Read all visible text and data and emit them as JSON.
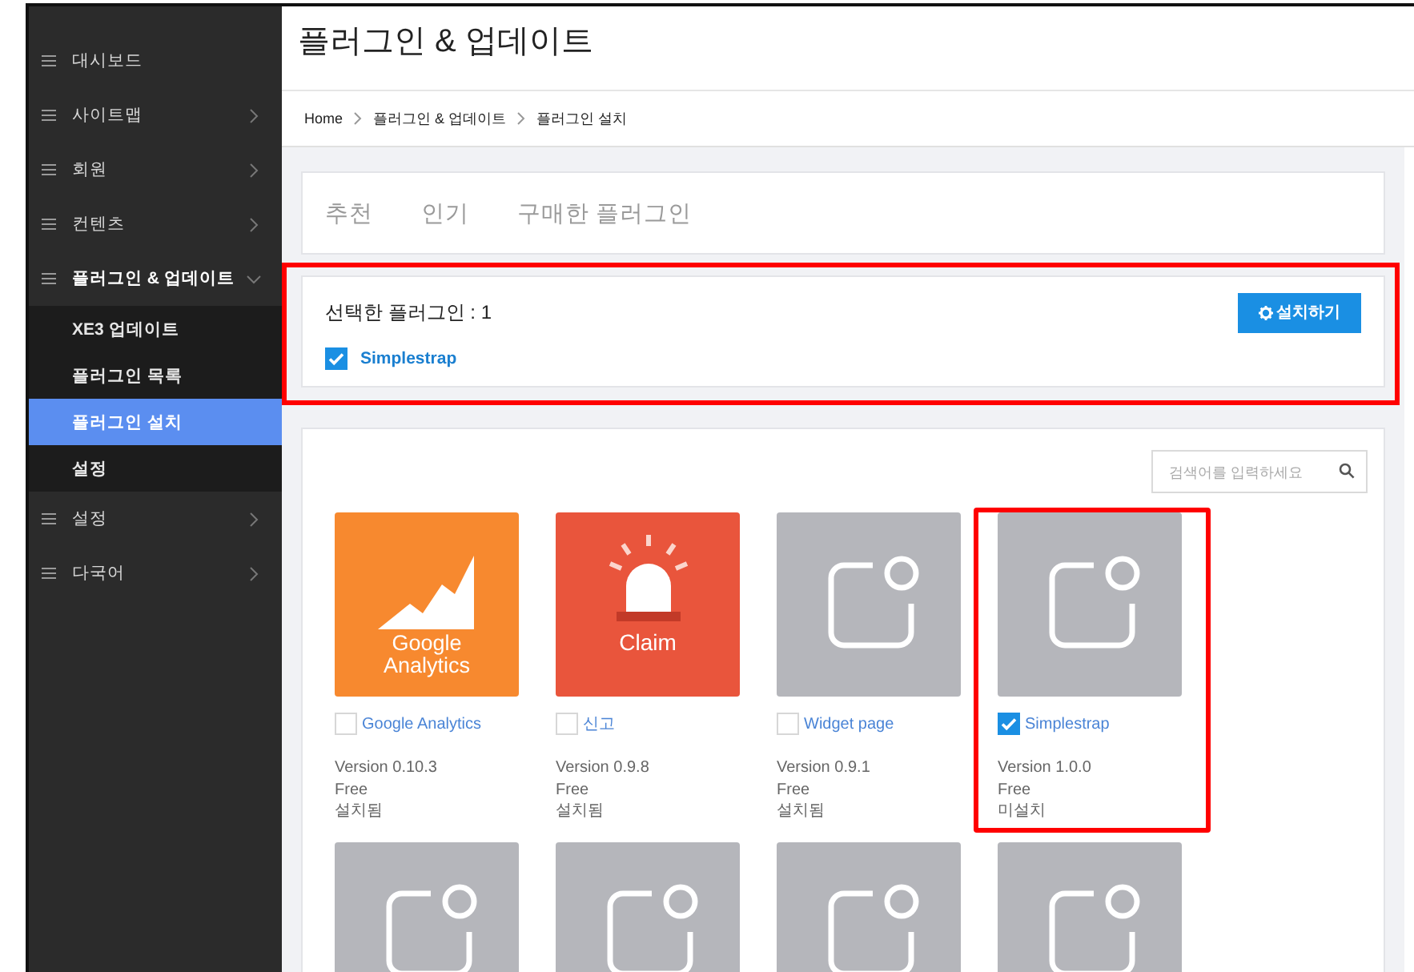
{
  "sidebar": {
    "items": [
      {
        "label": "대시보드",
        "expandable": false,
        "expanded": false
      },
      {
        "label": "사이트맵",
        "expandable": true,
        "expanded": false
      },
      {
        "label": "회원",
        "expandable": true,
        "expanded": false
      },
      {
        "label": "컨텐츠",
        "expandable": true,
        "expanded": false
      },
      {
        "label": "플러그인 & 업데이트",
        "expandable": true,
        "expanded": true,
        "children": [
          {
            "label": "XE3 업데이트",
            "selected": false
          },
          {
            "label": "플러그인 목록",
            "selected": false
          },
          {
            "label": "플러그인 설치",
            "selected": true
          },
          {
            "label": "설정",
            "selected": false
          }
        ]
      },
      {
        "label": "설정",
        "expandable": true,
        "expanded": false
      },
      {
        "label": "다국어",
        "expandable": true,
        "expanded": false
      }
    ]
  },
  "page": {
    "title": "플러그인 & 업데이트"
  },
  "breadcrumb": [
    "Home",
    "플러그인 & 업데이트",
    "플러그인 설치"
  ],
  "tabs": [
    {
      "label": "추천",
      "selected": false
    },
    {
      "label": "인기",
      "selected": false
    },
    {
      "label": "구매한 플러그인",
      "selected": false
    }
  ],
  "selection": {
    "highlighted": true,
    "label": "선택한 플러그인 : 1",
    "install_button": "설치하기",
    "items": [
      {
        "name": "Simplestrap",
        "checked": true
      }
    ]
  },
  "search": {
    "placeholder": "검색어를 입력하세요"
  },
  "plugins": [
    {
      "kind": "analytics",
      "thumb_lines": [
        "Google",
        "Analytics"
      ],
      "name": "Google Analytics",
      "checked": false,
      "version": "Version 0.10.3",
      "price": "Free",
      "status": "설치됨",
      "highlighted": false
    },
    {
      "kind": "alarm",
      "thumb_lines": [
        "Claim"
      ],
      "name": "신고",
      "checked": false,
      "version": "Version 0.9.8",
      "price": "Free",
      "status": "설치됨",
      "highlighted": false
    },
    {
      "kind": "default",
      "name": "Widget page",
      "checked": false,
      "version": "Version 0.9.1",
      "price": "Free",
      "status": "설치됨",
      "highlighted": false
    },
    {
      "kind": "default",
      "name": "Simplestrap",
      "checked": true,
      "version": "Version 1.0.0",
      "price": "Free",
      "status": "미설치",
      "highlighted": true
    },
    {
      "kind": "default"
    },
    {
      "kind": "default"
    },
    {
      "kind": "default"
    },
    {
      "kind": "default"
    }
  ]
}
